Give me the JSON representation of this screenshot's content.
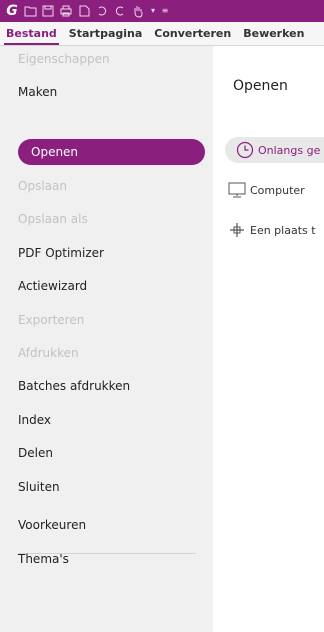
{
  "quick_access": {
    "icons": [
      "app-logo-icon",
      "open-folder-icon",
      "save-icon",
      "print-icon",
      "new-document-icon",
      "undo-icon",
      "redo-icon",
      "hand-tool-icon",
      "dropdown-icon",
      "customize-icon"
    ]
  },
  "ribbon": {
    "tabs": [
      {
        "label": "Bestand",
        "active": true
      },
      {
        "label": "Startpagina"
      },
      {
        "label": "Converteren"
      },
      {
        "label": "Bewerken"
      }
    ]
  },
  "sidebar": {
    "items": [
      {
        "label": "Eigenschappen",
        "state": "disabled"
      },
      {
        "label": "Maken",
        "state": "enabled"
      },
      {
        "label": "Openen",
        "state": "selected"
      },
      {
        "label": "Opslaan",
        "state": "disabled"
      },
      {
        "label": "Opslaan als",
        "state": "disabled"
      },
      {
        "label": "PDF Optimizer",
        "state": "enabled"
      },
      {
        "label": "Actiewizard",
        "state": "enabled"
      },
      {
        "label": "Exporteren",
        "state": "disabled"
      },
      {
        "label": "Afdrukken",
        "state": "disabled"
      },
      {
        "label": "Batches afdrukken",
        "state": "enabled"
      },
      {
        "label": "Index",
        "state": "enabled"
      },
      {
        "label": "Delen",
        "state": "enabled"
      },
      {
        "label": "Sluiten",
        "state": "enabled"
      },
      {
        "label": "Voorkeuren",
        "state": "enabled"
      },
      {
        "label": "Thema's",
        "state": "enabled"
      }
    ]
  },
  "main": {
    "title": "Openen",
    "options": [
      {
        "label": "Onlangs ge",
        "icon": "clock-icon",
        "selected": true
      },
      {
        "label": "Computer",
        "icon": "computer-icon"
      },
      {
        "label": "Een plaats t",
        "icon": "add-place-icon"
      }
    ]
  },
  "colors": {
    "accent": "#8a1f7e",
    "sidebar_bg": "#f0f0f0",
    "disabled_text": "#c2c2c2"
  }
}
